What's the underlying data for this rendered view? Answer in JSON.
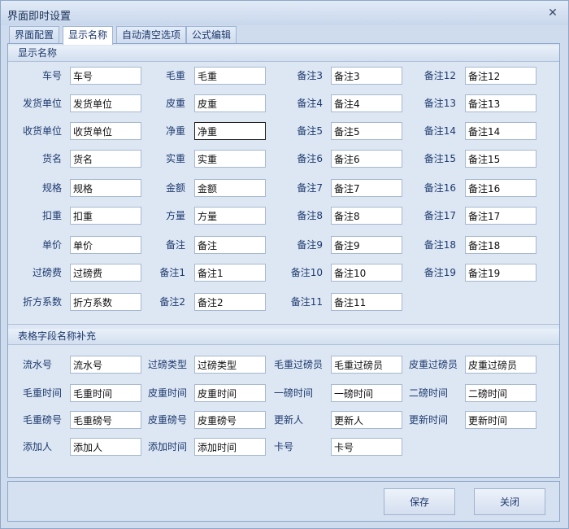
{
  "window": {
    "title": "界面即时设置",
    "close_label": "✕"
  },
  "tabs": [
    {
      "label": "界面配置"
    },
    {
      "label": "显示名称"
    },
    {
      "label": "自动清空选项"
    },
    {
      "label": "公式编辑"
    }
  ],
  "group1": {
    "title": "显示名称",
    "col1": [
      {
        "label": "车号",
        "value": "车号"
      },
      {
        "label": "发货单位",
        "value": "发货单位"
      },
      {
        "label": "收货单位",
        "value": "收货单位"
      },
      {
        "label": "货名",
        "value": "货名"
      },
      {
        "label": "规格",
        "value": "规格"
      },
      {
        "label": "扣重",
        "value": "扣重"
      },
      {
        "label": "单价",
        "value": "单价"
      },
      {
        "label": "过磅费",
        "value": "过磅费"
      },
      {
        "label": "折方系数",
        "value": "折方系数"
      }
    ],
    "col2": [
      {
        "label": "毛重",
        "value": "毛重"
      },
      {
        "label": "皮重",
        "value": "皮重"
      },
      {
        "label": "净重",
        "value": "净重"
      },
      {
        "label": "实重",
        "value": "实重"
      },
      {
        "label": "金额",
        "value": "金额"
      },
      {
        "label": "方量",
        "value": "方量"
      },
      {
        "label": "备注",
        "value": "备注"
      },
      {
        "label": "备注1",
        "value": "备注1"
      },
      {
        "label": "备注2",
        "value": "备注2"
      }
    ],
    "col3": [
      {
        "label": "备注3",
        "value": "备注3"
      },
      {
        "label": "备注4",
        "value": "备注4"
      },
      {
        "label": "备注5",
        "value": "备注5"
      },
      {
        "label": "备注6",
        "value": "备注6"
      },
      {
        "label": "备注7",
        "value": "备注7"
      },
      {
        "label": "备注8",
        "value": "备注8"
      },
      {
        "label": "备注9",
        "value": "备注9"
      },
      {
        "label": "备注10",
        "value": "备注10"
      },
      {
        "label": "备注11",
        "value": "备注11"
      }
    ],
    "col4": [
      {
        "label": "备注12",
        "value": "备注12"
      },
      {
        "label": "备注13",
        "value": "备注13"
      },
      {
        "label": "备注14",
        "value": "备注14"
      },
      {
        "label": "备注15",
        "value": "备注15"
      },
      {
        "label": "备注16",
        "value": "备注16"
      },
      {
        "label": "备注17",
        "value": "备注17"
      },
      {
        "label": "备注18",
        "value": "备注18"
      },
      {
        "label": "备注19",
        "value": "备注19"
      }
    ]
  },
  "group2": {
    "title": "表格字段名称补充",
    "col1": [
      {
        "label": "流水号",
        "value": "流水号"
      },
      {
        "label": "毛重时间",
        "value": "毛重时间"
      },
      {
        "label": "毛重磅号",
        "value": "毛重磅号"
      },
      {
        "label": "添加人",
        "value": "添加人"
      }
    ],
    "col2": [
      {
        "label": "过磅类型",
        "value": "过磅类型"
      },
      {
        "label": "皮重时间",
        "value": "皮重时间"
      },
      {
        "label": "皮重磅号",
        "value": "皮重磅号"
      },
      {
        "label": "添加时间",
        "value": "添加时间"
      }
    ],
    "col3": [
      {
        "label": "毛重过磅员",
        "value": "毛重过磅员"
      },
      {
        "label": "一磅时间",
        "value": "一磅时间"
      },
      {
        "label": "更新人",
        "value": "更新人"
      },
      {
        "label": "卡号",
        "value": "卡号"
      }
    ],
    "col4": [
      {
        "label": "皮重过磅员",
        "value": "皮重过磅员"
      },
      {
        "label": "二磅时间",
        "value": "二磅时间"
      },
      {
        "label": "更新时间",
        "value": "更新时间"
      }
    ]
  },
  "footer": {
    "save_label": "保存",
    "close_label": "关闭"
  }
}
